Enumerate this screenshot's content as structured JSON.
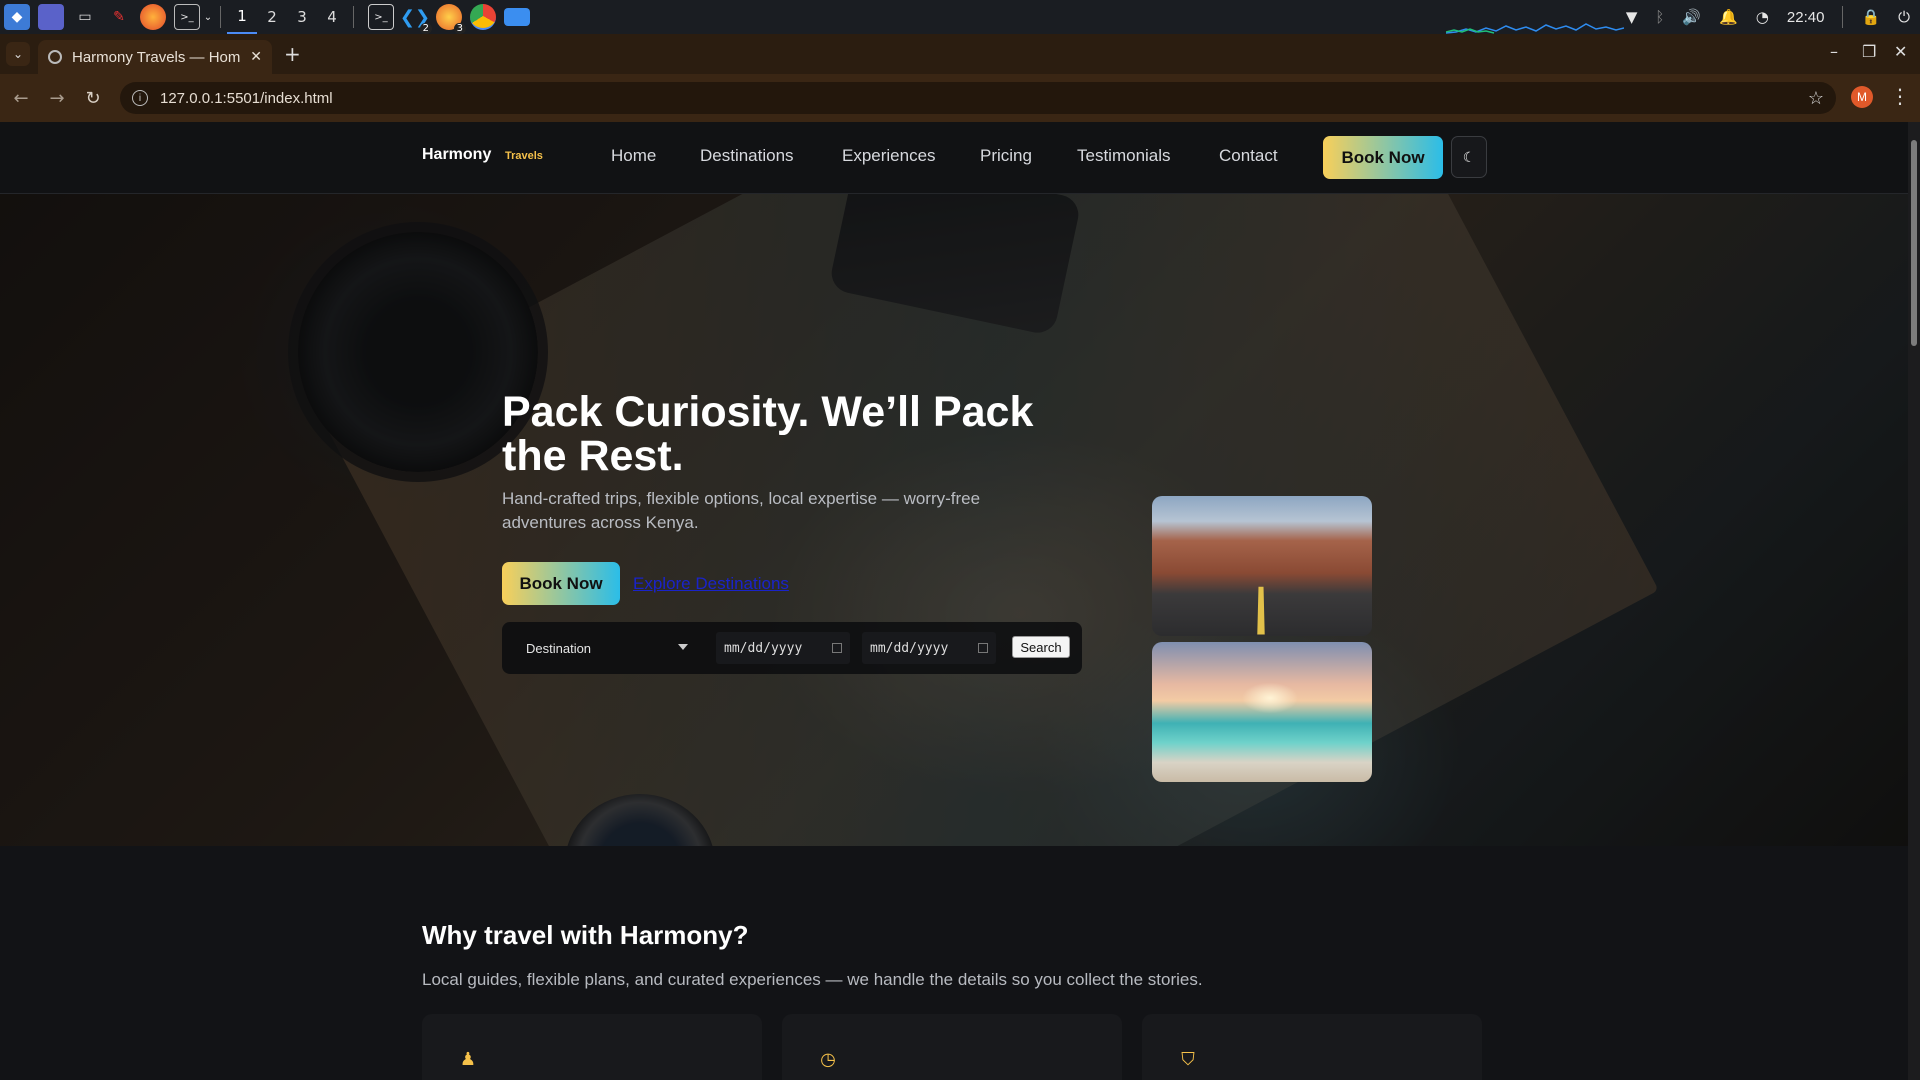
{
  "taskbar": {
    "workspaces": [
      "1",
      "2",
      "3",
      "4"
    ],
    "active_workspace": "1",
    "vscode_badge": "2",
    "app_badge": "3",
    "clock": "22:40"
  },
  "browser": {
    "tab_title": "Harmony Travels — Hom",
    "url": "127.0.0.1:5501/index.html",
    "profile_initial": "M"
  },
  "site": {
    "brand": "Harmony",
    "brand_sub": "Travels",
    "nav": [
      "Home",
      "Destinations",
      "Experiences",
      "Pricing",
      "Testimonials",
      "Contact"
    ],
    "book_now": "Book Now",
    "theme_toggle_icon": "moon-icon"
  },
  "hero": {
    "title": "Pack Curiosity. We’ll Pack the Rest.",
    "subtitle": "Hand-crafted trips, flexible options, local expertise — worry-free adventures across Kenya.",
    "cta_primary": "Book Now",
    "cta_secondary": "Explore Destinations",
    "search": {
      "destination_value": "Destination",
      "date_from_placeholder": "mm/dd/yyyy",
      "date_to_placeholder": "mm/dd/yyyy",
      "search_label": "Search"
    }
  },
  "why": {
    "title": "Why travel with Harmony?",
    "subtitle": "Local guides, flexible plans, and curated experiences — we handle the details so you collect the stories.",
    "cards": [
      {
        "icon": "person-icon"
      },
      {
        "icon": "clock-icon"
      },
      {
        "icon": "shield-icon"
      }
    ]
  },
  "colors": {
    "accent_gold": "#f5c14a",
    "accent_cyan": "#2bbde8",
    "page_bg": "#121316"
  }
}
